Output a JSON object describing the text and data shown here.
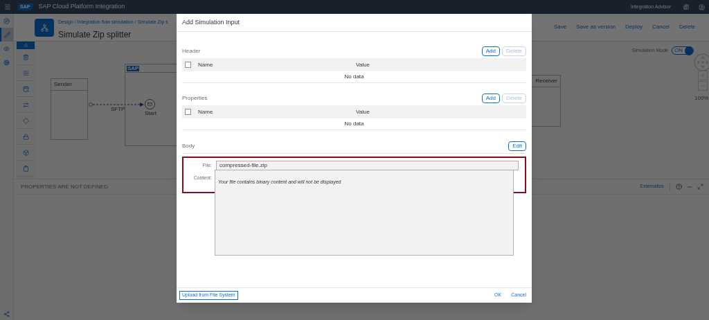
{
  "shell": {
    "logo": "SAP",
    "title": "SAP Cloud Platform Integration",
    "right_link": "Integration Advisor"
  },
  "nav_items": [
    {
      "selected": false
    },
    {
      "selected": true
    },
    {
      "selected": false
    },
    {
      "selected": false
    }
  ],
  "page": {
    "breadcrumb": "Design / Integration flow simulation / Simulate Zip s",
    "title": "Simulate Zip splitter",
    "actions": [
      "Save",
      "Save as version",
      "Deploy",
      "Cancel",
      "Delete"
    ]
  },
  "canvas": {
    "simulation_mode": {
      "label": "Simulation Mode",
      "state_text": "ON",
      "on": true
    },
    "sender": "Sender",
    "edge_label": "SFTP",
    "start": "Start",
    "process_logo": "SAP",
    "receiver": "Receiver",
    "zoom": "100%"
  },
  "properties_panel": {
    "message": "PROPERTIES ARE NOT DEFINED",
    "link": "Externalize"
  },
  "dialog": {
    "title": "Add Simulation Input",
    "sections": [
      {
        "title": "Header",
        "add": "Add",
        "delete": "Delete",
        "delete_disabled": true,
        "columns": [
          "Name",
          "Value"
        ],
        "checked": false,
        "empty": "No data"
      },
      {
        "title": "Properties",
        "add": "Add",
        "delete": "Delete",
        "delete_disabled": true,
        "columns": [
          "Name",
          "Value"
        ],
        "checked": false,
        "empty": "No data"
      }
    ],
    "body": {
      "title": "Body",
      "edit": "Edit",
      "file_label": "File:",
      "file": "compressed-file.zip",
      "content_label": "Content:",
      "content": "Your file contains binary content and will not be displayed"
    },
    "footer": {
      "upload": "Upload from File System",
      "ok": "OK",
      "cancel": "Cancel"
    }
  }
}
